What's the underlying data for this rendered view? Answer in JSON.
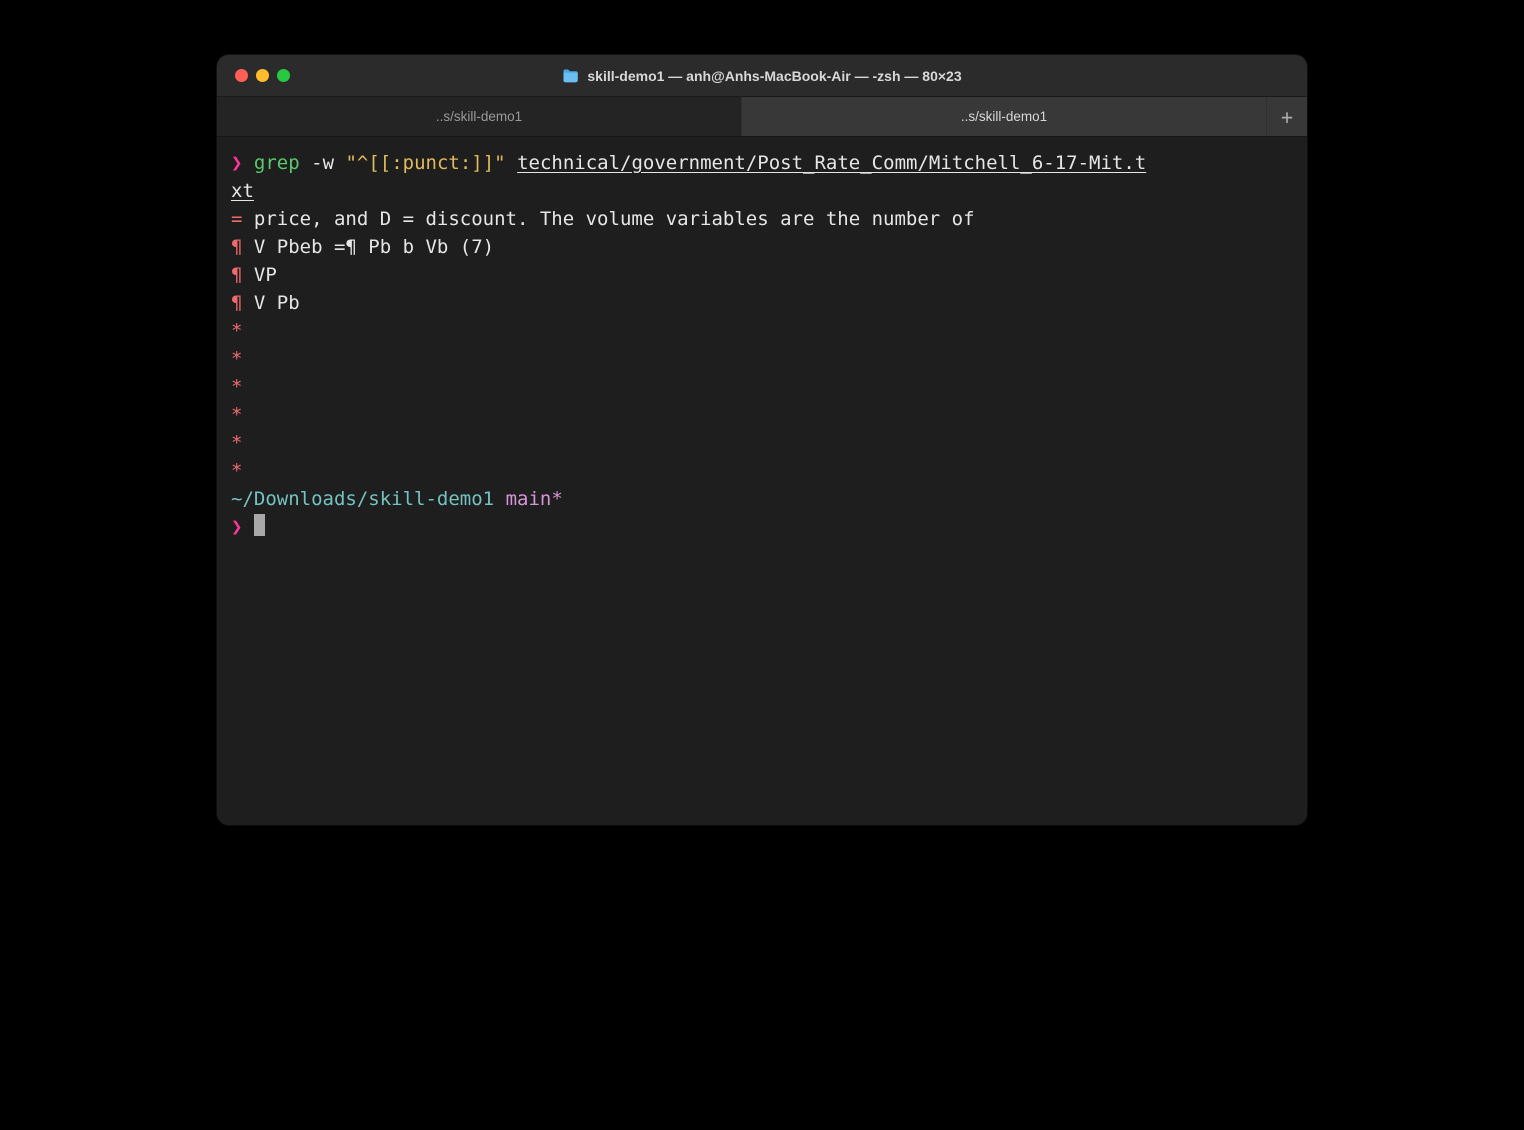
{
  "window": {
    "title": "skill-demo1 — anh@Anhs-MacBook-Air — -zsh — 80×23"
  },
  "tabs": [
    {
      "label": "..s/skill-demo1",
      "active": false
    },
    {
      "label": "..s/skill-demo1",
      "active": true
    }
  ],
  "newtab_label": "+",
  "terminal": {
    "prompt_caret": "❯",
    "cmd_name": "grep",
    "cmd_flag": "-w",
    "cmd_pattern": "\"^[[:punct:]]\"",
    "cmd_arg_part1": "technical/government/Post_Rate_Comm/Mitchell_6-17-Mit.t",
    "cmd_arg_part2": "xt",
    "output_lines": [
      {
        "lead": "=",
        "rest": " price, and D = discount. The volume variables are the number of"
      },
      {
        "lead": "¶",
        "rest": " V Pbeb =¶ Pb b Vb (7)"
      },
      {
        "lead": "¶",
        "rest": " VP"
      },
      {
        "lead": "¶",
        "rest": " V Pb"
      },
      {
        "lead": "*",
        "rest": ""
      },
      {
        "lead": "*",
        "rest": ""
      },
      {
        "lead": "*",
        "rest": ""
      },
      {
        "lead": "*",
        "rest": ""
      },
      {
        "lead": "*",
        "rest": ""
      },
      {
        "lead": "*",
        "rest": ""
      }
    ],
    "cwd": "~/Downloads/skill-demo1",
    "branch": "main*"
  }
}
